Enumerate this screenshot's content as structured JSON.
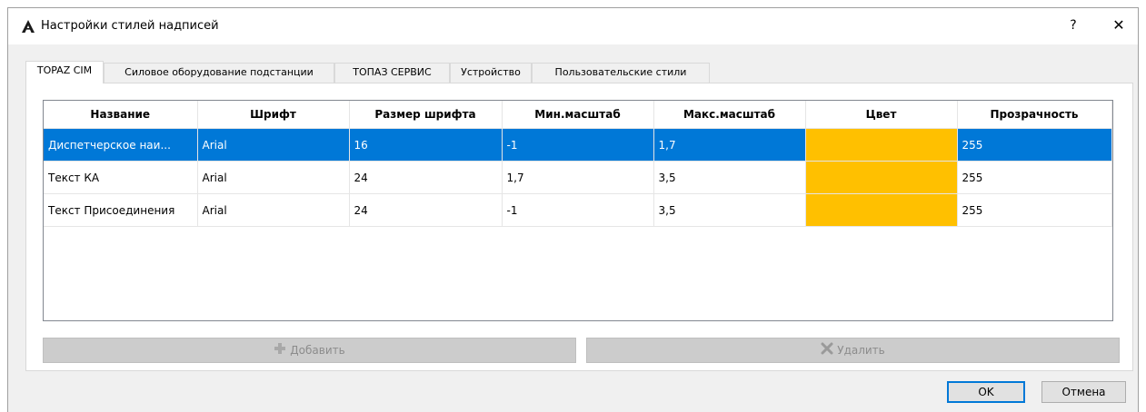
{
  "window": {
    "title": "Настройки стилей надписей",
    "help_glyph": "?",
    "close_glyph": "✕"
  },
  "tabs": [
    {
      "label": "TOPAZ CIM",
      "active": true
    },
    {
      "label": "Силовое оборудование подстанции",
      "active": false
    },
    {
      "label": "ТОПАЗ СЕРВИС",
      "active": false
    },
    {
      "label": "Устройство",
      "active": false
    },
    {
      "label": "Пользовательские стили",
      "active": false
    }
  ],
  "table": {
    "columns": [
      "Название",
      "Шрифт",
      "Размер шрифта",
      "Мин.масштаб",
      "Макс.масштаб",
      "Цвет",
      "Прозрачность"
    ],
    "rows": [
      {
        "name": "Диспетчерское наи...",
        "font": "Arial",
        "size": "16",
        "min_scale": "-1",
        "max_scale": "1,7",
        "color": "#ffc000",
        "opacity": "255",
        "selected": true
      },
      {
        "name": "Текст КА",
        "font": "Arial",
        "size": "24",
        "min_scale": "1,7",
        "max_scale": "3,5",
        "color": "#ffc000",
        "opacity": "255",
        "selected": false
      },
      {
        "name": "Текст Присоединения",
        "font": "Arial",
        "size": "24",
        "min_scale": "-1",
        "max_scale": "3,5",
        "color": "#ffc000",
        "opacity": "255",
        "selected": false
      }
    ]
  },
  "actions": {
    "add_label": "Добавить",
    "add_icon": "plus-icon",
    "delete_label": "Удалить",
    "delete_icon": "x-delete-icon"
  },
  "buttons": {
    "ok": "OK",
    "cancel": "Отмена"
  },
  "colors": {
    "selection": "#0078d7",
    "swatch": "#ffc000"
  }
}
